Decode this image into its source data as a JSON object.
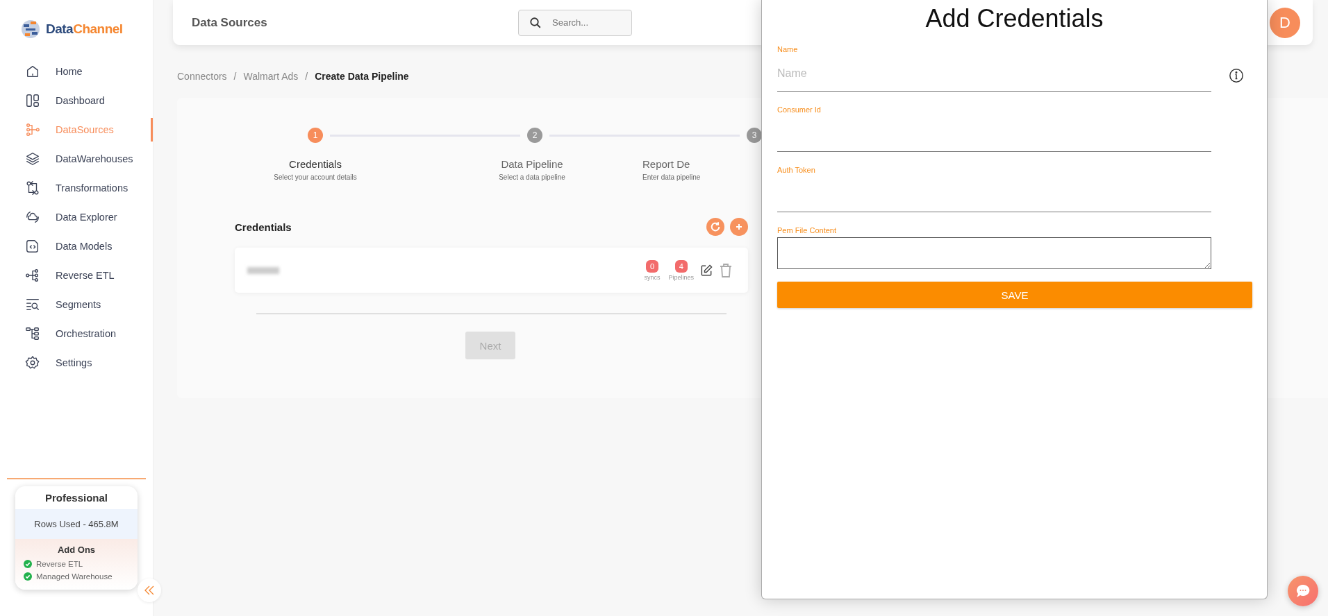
{
  "logo": {
    "primary": "Data",
    "accent": "Channel"
  },
  "sidebar": {
    "items": [
      {
        "label": "Home",
        "selected": false
      },
      {
        "label": "Dashboard",
        "selected": false
      },
      {
        "label": "DataSources",
        "selected": true
      },
      {
        "label": "DataWarehouses",
        "selected": false
      },
      {
        "label": "Transformations",
        "selected": false
      },
      {
        "label": "Data Explorer",
        "selected": false
      },
      {
        "label": "Data Models",
        "selected": false
      },
      {
        "label": "Reverse ETL",
        "selected": false
      },
      {
        "label": "Segments",
        "selected": false
      },
      {
        "label": "Orchestration",
        "selected": false
      },
      {
        "label": "Settings",
        "selected": false
      }
    ]
  },
  "plan": {
    "name": "Professional",
    "rows_used": "Rows Used - 465.8M",
    "addons_title": "Add Ons",
    "addons": [
      {
        "label": "Reverse ETL",
        "checked": true
      },
      {
        "label": "Managed Warehouse",
        "checked": true
      }
    ]
  },
  "header": {
    "title": "Data Sources",
    "search": {
      "placeholder": "Search..."
    },
    "avatar": "D"
  },
  "breadcrumb": [
    {
      "label": "Connectors",
      "current": false,
      "separator": "/"
    },
    {
      "label": "Walmart Ads",
      "current": false,
      "separator": "/"
    },
    {
      "label": "Create Data Pipeline",
      "current": true
    }
  ],
  "stepper": [
    {
      "number": "1",
      "title": "Credentials",
      "subtitle": "Select your account details",
      "selected": true
    },
    {
      "number": "2",
      "title": "Data Pipeline",
      "subtitle": "Select a data pipeline",
      "selected": false
    },
    {
      "number": "3",
      "title": "Report De",
      "subtitle": "Enter data pipeline",
      "selected": false
    }
  ],
  "credentials": {
    "title": "Credentials",
    "items": [
      {
        "syncs": "0",
        "syncs_label": "syncs",
        "pipelines": "4",
        "pipelines_label": "Pipelines"
      }
    ]
  },
  "next_button": {
    "label": "Next",
    "disabled": true
  },
  "drawer": {
    "title": "Add Credentials",
    "fields": [
      {
        "kind": "input",
        "label": "Name",
        "placeholder": "Name"
      },
      {
        "kind": "input",
        "label": "Consumer Id"
      },
      {
        "kind": "input",
        "label": "Auth Token"
      },
      {
        "kind": "textarea",
        "label": "Pem File Content"
      }
    ],
    "save": "SAVE"
  }
}
